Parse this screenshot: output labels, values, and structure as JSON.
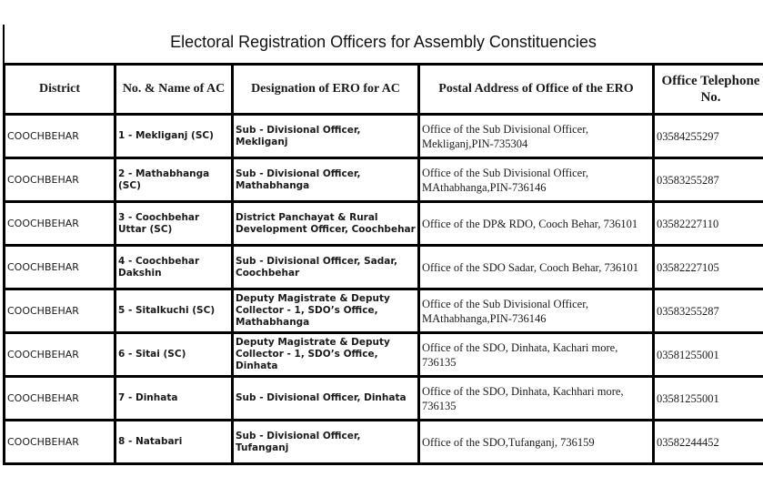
{
  "title": "Electoral Registration Officers for Assembly Constituencies",
  "table": {
    "headers": {
      "district": "District",
      "ac": "No. & Name of AC",
      "designation": "Designation of ERO for AC",
      "address": "Postal Address of Office of the ERO",
      "telephone": "Office Telephone No."
    },
    "rows": [
      {
        "district": "COOCHBEHAR",
        "ac": "1 - Mekliganj (SC)",
        "designation": "Sub - Divisional Officer, Mekliganj",
        "address": "Office of the Sub Divisional Officer, Mekliganj,PIN-735304",
        "telephone": "03584255297"
      },
      {
        "district": "COOCHBEHAR",
        "ac": "2 - Mathabhanga (SC)",
        "designation": "Sub - Divisional Officer, Mathabhanga",
        "address": "Office of the Sub Divisional Officer, MAthabhanga,PIN-736146",
        "telephone": "03583255287"
      },
      {
        "district": "COOCHBEHAR",
        "ac": "3 - Coochbehar Uttar (SC)",
        "designation": "District Panchayat & Rural Development Officer, Coochbehar",
        "address": "Office of the DP& RDO, Cooch Behar, 736101",
        "telephone": "03582227110"
      },
      {
        "district": "COOCHBEHAR",
        "ac": "4 - Coochbehar Dakshin",
        "designation": "Sub - Divisional Officer, Sadar, Coochbehar",
        "address": "Office of the SDO Sadar, Cooch Behar, 736101",
        "telephone": "03582227105"
      },
      {
        "district": "COOCHBEHAR",
        "ac": "5 - Sitalkuchi (SC)",
        "designation": "Deputy Magistrate & Deputy Collector - 1, SDO’s Office, Mathabhanga",
        "address": "Office of the Sub Divisional Officer, MAthabhanga,PIN-736146",
        "telephone": "03583255287"
      },
      {
        "district": "COOCHBEHAR",
        "ac": "6 - Sitai (SC)",
        "designation": "Deputy Magistrate & Deputy Collector - 1, SDO’s Office, Dinhata",
        "address": "Office of the SDO, Dinhata, Kachari more, 736135",
        "telephone": "03581255001"
      },
      {
        "district": "COOCHBEHAR",
        "ac": "7 - Dinhata",
        "designation": "Sub - Divisional Officer, Dinhata",
        "address": "Office of the SDO, Dinhata, Kachhari more, 736135",
        "telephone": "03581255001"
      },
      {
        "district": "COOCHBEHAR",
        "ac": "8 - Natabari",
        "designation": "Sub - Divisional Officer, Tufanganj",
        "address": "Office of the SDO,Tufanganj, 736159",
        "telephone": "03582244452"
      }
    ]
  }
}
